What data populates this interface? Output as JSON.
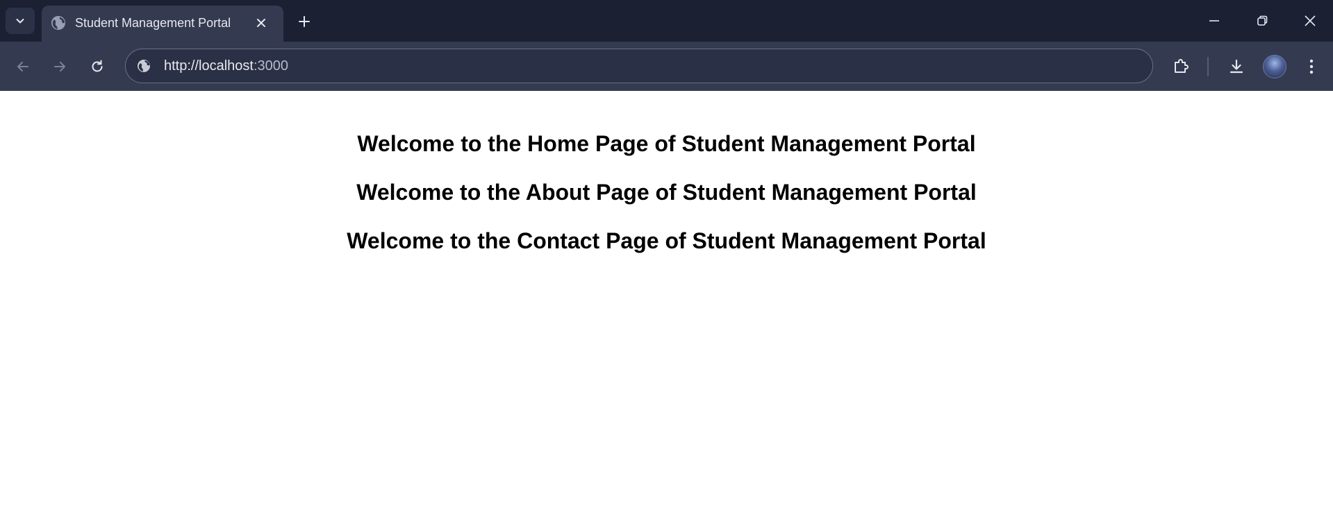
{
  "browser": {
    "tab": {
      "title": "Student Management Portal"
    },
    "address_bar": {
      "url_host": "http://localhost",
      "url_port": ":3000"
    },
    "icons": {
      "tab_list": "chevron-down-icon",
      "favicon": "globe-icon",
      "tab_close": "close-icon",
      "new_tab": "plus-icon",
      "minimize": "minimize-icon",
      "restore": "restore-icon",
      "close_window": "close-icon",
      "back": "arrow-left-icon",
      "forward": "arrow-right-icon",
      "reload": "reload-icon",
      "site_info": "globe-icon",
      "extensions": "puzzle-icon",
      "downloads": "download-icon",
      "profile": "avatar",
      "menu": "kebab-menu-icon"
    },
    "colors": {
      "titlebar": "#1b2033",
      "toolbar": "#343a50",
      "page_background": "#ffffff"
    }
  },
  "page": {
    "headings": [
      "Welcome to the Home Page of Student Management Portal",
      "Welcome to the About Page of Student Management Portal",
      "Welcome to the Contact Page of Student Management Portal"
    ]
  }
}
